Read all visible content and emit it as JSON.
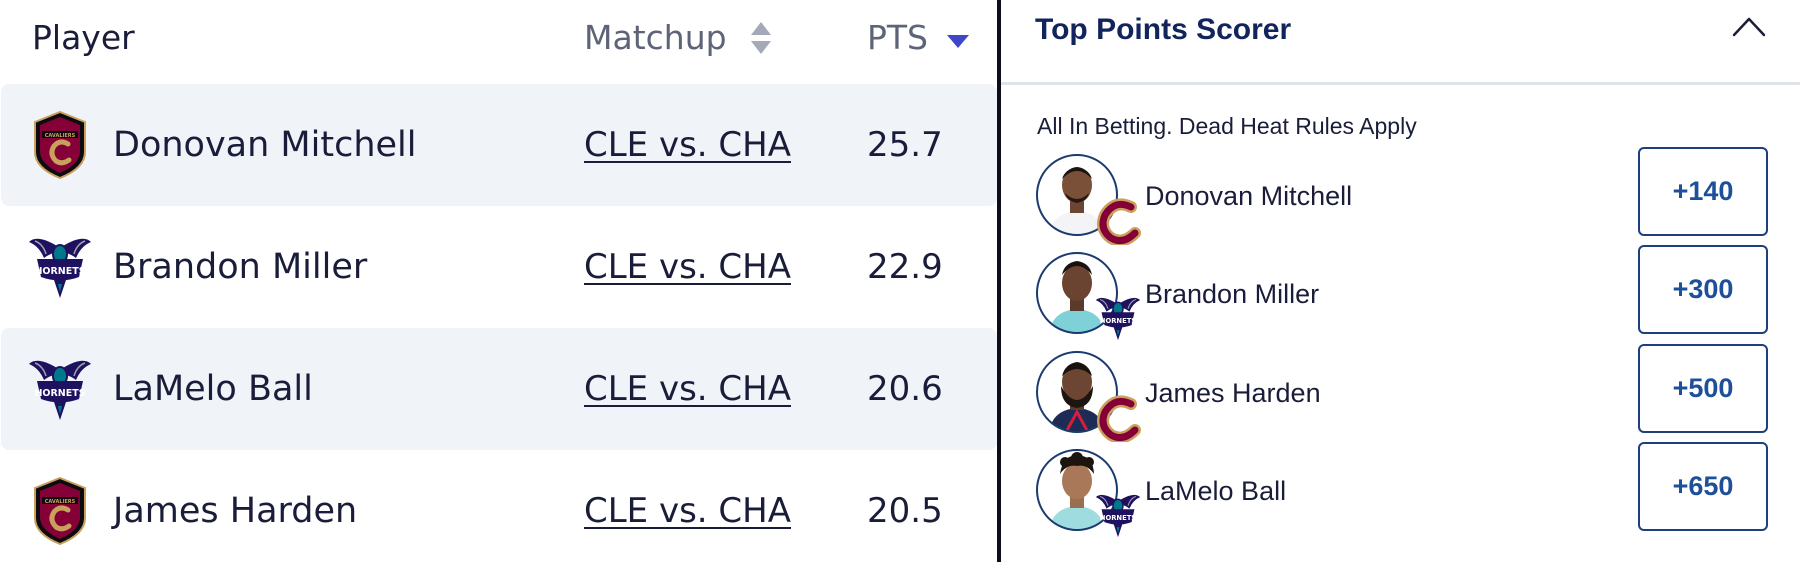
{
  "table": {
    "headers": {
      "player": "Player",
      "matchup": "Matchup",
      "pts": "PTS"
    },
    "rows": [
      {
        "player": "Donovan Mitchell",
        "team_logo": "cavaliers-logo-icon",
        "matchup": "CLE vs. CHA",
        "pts": "25.7"
      },
      {
        "player": "Brandon Miller",
        "team_logo": "hornets-logo-icon",
        "matchup": "CLE vs. CHA",
        "pts": "22.9"
      },
      {
        "player": "LaMelo Ball",
        "team_logo": "hornets-logo-icon",
        "matchup": "CLE vs. CHA",
        "pts": "20.6"
      },
      {
        "player": "James Harden",
        "team_logo": "cavaliers-logo-icon",
        "matchup": "CLE vs. CHA",
        "pts": "20.5"
      }
    ]
  },
  "panel": {
    "title": "Top Points Scorer",
    "subtitle": "All In Betting. Dead Heat Rules Apply",
    "entries": [
      {
        "name": "Donovan Mitchell",
        "odds": "+140",
        "team_badge": "cavaliers-c-icon"
      },
      {
        "name": "Brandon Miller",
        "odds": "+300",
        "team_badge": "hornets-logo-icon"
      },
      {
        "name": "James Harden",
        "odds": "+500",
        "team_badge": "cavaliers-c-icon"
      },
      {
        "name": "LaMelo Ball",
        "odds": "+650",
        "team_badge": "hornets-logo-icon"
      }
    ]
  },
  "colors": {
    "text_primary": "#1a1d3a",
    "header_muted": "#5d6478",
    "row_shade": "#f0f3f8",
    "sort_active": "#3f46c7",
    "panel_title": "#12245c",
    "odds_text": "#1d4f9a",
    "odds_border": "#1d3f7e",
    "cavaliers_wine": "#860038",
    "cavaliers_gold": "#c9a15d",
    "hornets_purple": "#1d1160",
    "hornets_teal": "#00788c"
  }
}
